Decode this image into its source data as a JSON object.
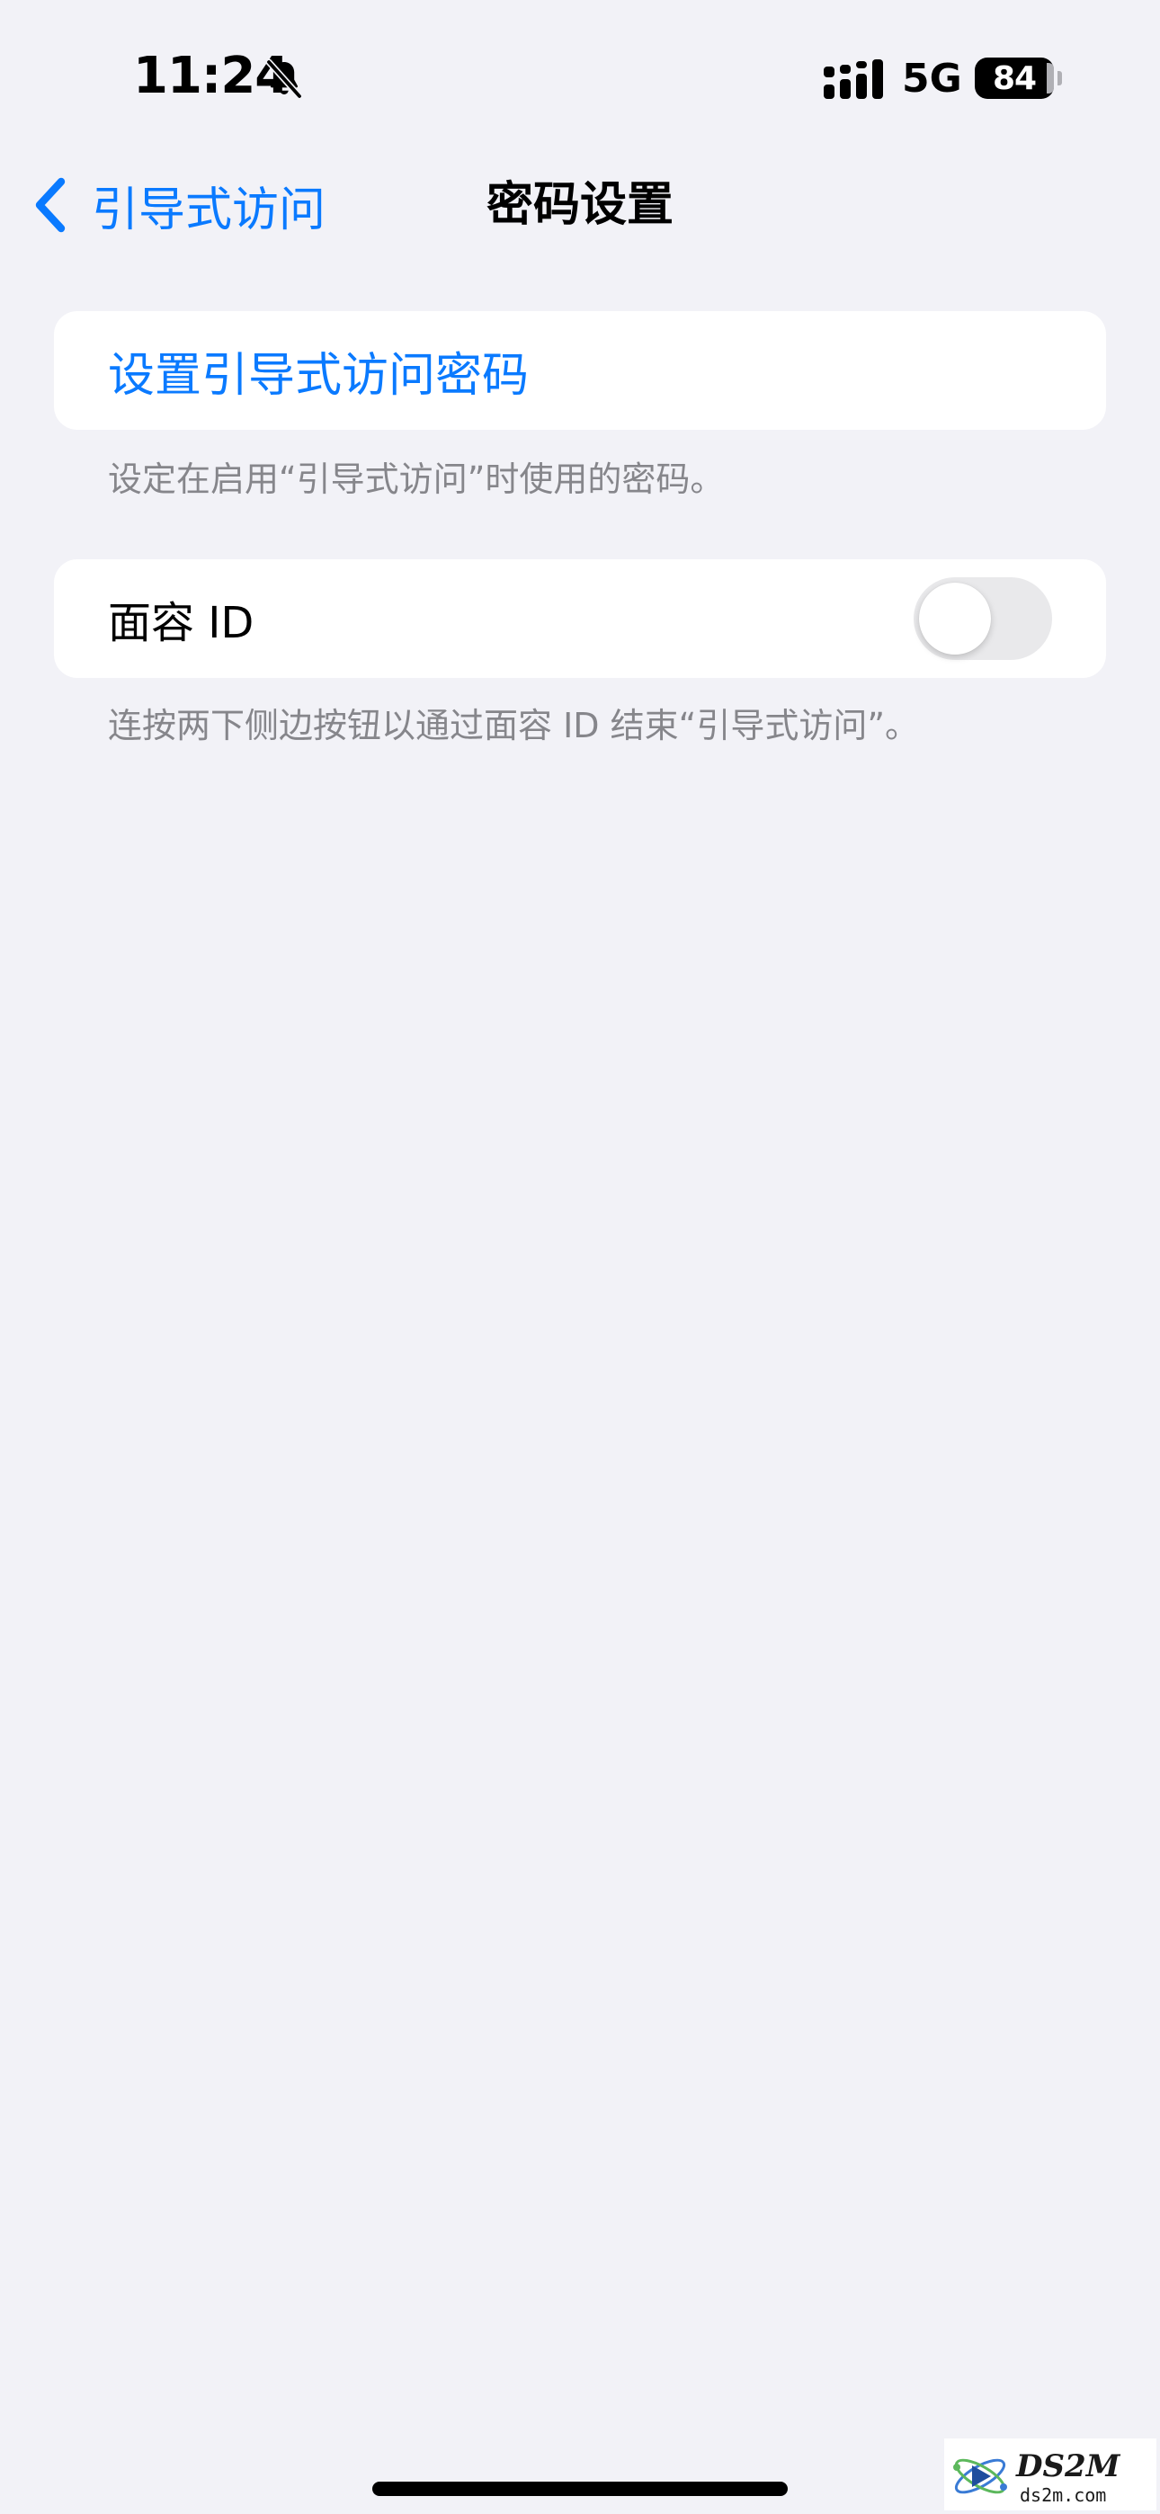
{
  "status_bar": {
    "time": "11:24",
    "network": "5G",
    "battery": "84"
  },
  "nav": {
    "back_label": "引导式访问",
    "title": "密码设置"
  },
  "sections": {
    "passcode": {
      "link_label": "设置引导式访问密码",
      "footer": "设定在启用“引导式访问”时使用的密码。"
    },
    "face_id": {
      "label": "面容 ID",
      "enabled": false,
      "footer": "连按两下侧边按钮以通过面容 ID 结束“引导式访问”。"
    }
  },
  "watermark": {
    "brand": "DS2M",
    "domain": "ds2m.com"
  },
  "colors": {
    "accent": "#0A7AFF",
    "background": "#F2F2F7",
    "toggle_off": "#E9E9EB",
    "footer_text": "#86868B"
  },
  "icons": {
    "mute": "bell-slash-icon",
    "signal": "cellular-signal-icon",
    "back": "chevron-left-icon"
  }
}
